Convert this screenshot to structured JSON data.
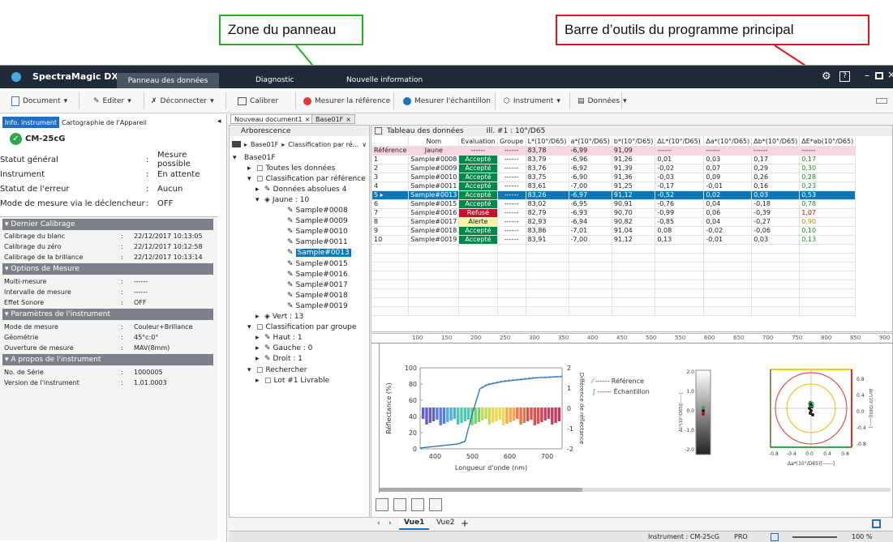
{
  "callouts": {
    "panel_zone": "Zone du panneau",
    "main_toolbar": "Barre d’outils du programme principal"
  },
  "colors": {
    "callout_panel": "#22b21e",
    "callout_toolbar": "#e0141e",
    "titlebar": "#1f2a36",
    "accept": "#00884a",
    "refuse": "#c8102e",
    "alert": "#f7f3a3",
    "selected_row": "#0d77b8"
  },
  "app": {
    "title": "SpectraMagic DX",
    "tabs": [
      "Panneau des données",
      "Diagnostic",
      "Nouvelle information"
    ],
    "title_icons": [
      "gear-icon",
      "help-icon",
      "minimize-icon",
      "restore-icon",
      "close-icon"
    ]
  },
  "toolbar": {
    "document": "Document",
    "edit": "Editer",
    "disconnect": "Déconnecter",
    "calibrate": "Calibrer",
    "measure_ref": "Mesurer la référence",
    "measure_sample": "Mesurer l'échantillon",
    "instrument": "Instrument",
    "data": "Données"
  },
  "left": {
    "tabs": [
      "Info. instrument",
      "Cartographie de l'Appareil"
    ],
    "model": "CM-25cG",
    "status": [
      {
        "label": "Statut général",
        "value": "Mesure possible"
      },
      {
        "label": "Instrument",
        "value": "En attente"
      },
      {
        "label": "Statut de l'erreur",
        "value": "Aucun"
      },
      {
        "label": "Mode de mesure via le déclencheur",
        "value": "OFF"
      }
    ],
    "sections": [
      {
        "title": "Dernier Calibrage",
        "rows": [
          {
            "label": "Calibrage du blanc",
            "value": "22/12/2017 10:13:05"
          },
          {
            "label": "Calibrage du zéro",
            "value": "22/12/2017 10:12:58"
          },
          {
            "label": "Calibrage de la brillance",
            "value": "22/12/2017 10:13:14"
          }
        ]
      },
      {
        "title": "Options de Mesure",
        "rows": [
          {
            "label": "Multi-mesure",
            "value": "------"
          },
          {
            "label": "Intervalle de mesure",
            "value": "------"
          },
          {
            "label": "Effet Sonore",
            "value": "OFF"
          }
        ]
      },
      {
        "title": "Paramètres de l'instrument",
        "rows": [
          {
            "label": "Mode de mesure",
            "value": "Couleur+Brillance"
          },
          {
            "label": "Géométrie",
            "value": "45°c:0°"
          },
          {
            "label": "Ouverture de mesure",
            "value": "MAV(8mm)"
          }
        ]
      },
      {
        "title": "A propos de l'instrument",
        "rows": [
          {
            "label": "No. de Série",
            "value": "1000005"
          },
          {
            "label": "Version de l'instrument",
            "value": "1.01.0003"
          }
        ]
      }
    ]
  },
  "doc_tabs": [
    "Nouveau document1",
    "Base01F"
  ],
  "tree": {
    "header": "Arborescence",
    "breadcrumb": [
      "Base01F",
      "Classification par ré..."
    ],
    "items": [
      "Base01F",
      "Toutes les données",
      "Classification par référence",
      "Données absolues 4",
      "Jaune : 10",
      "Sample#0008",
      "Sample#0009",
      "Sample#0010",
      "Sample#0011",
      "Sample#0013",
      "Sample#0015",
      "Sample#0016",
      "Sample#0017",
      "Sample#0018",
      "Sample#0019",
      "Vert : 13",
      "Classification par groupe",
      "Haut : 1",
      "Gauche : 0",
      "Droit : 1",
      "Rechercher",
      "Lot #1 Livrable"
    ]
  },
  "table": {
    "title": "Tableau des données",
    "illuminant": "Ill. #1 : 10°/D65",
    "columns": [
      "",
      "Nom",
      "Evaluation",
      "Groupe",
      "L*(10°/D65)",
      "a*(10°/D65)",
      "b*(10°/D65)",
      "ΔL*(10°/D65)",
      "Δa*(10°/D65)",
      "Δb*(10°/D65)",
      "ΔE*ab(10°/D65)"
    ],
    "reference": [
      "Référence",
      "Jaune",
      "------",
      "------",
      "83,78",
      "-6,99",
      "91,09",
      "------",
      "------",
      "------",
      "------"
    ],
    "rows": [
      [
        "1",
        "Sample#0008",
        "Accepté",
        "------",
        "83,79",
        "-6,96",
        "91,26",
        "0,01",
        "0,03",
        "0,17",
        "0,17"
      ],
      [
        "2",
        "Sample#0009",
        "Accepté",
        "------",
        "83,76",
        "-6,92",
        "91,39",
        "-0,02",
        "0,07",
        "0,29",
        "0,30"
      ],
      [
        "3",
        "Sample#0010",
        "Accepté",
        "------",
        "83,75",
        "-6,90",
        "91,36",
        "-0,03",
        "0,09",
        "0,26",
        "0,28"
      ],
      [
        "4",
        "Sample#0011",
        "Accepté",
        "------",
        "83,61",
        "-7,00",
        "91,25",
        "-0,17",
        "-0,01",
        "0,16",
        "0,23"
      ],
      [
        "5",
        "Sample#0013",
        "Accepté",
        "------",
        "83,26",
        "-6,97",
        "91,12",
        "-0,52",
        "0,02",
        "0,03",
        "0,53"
      ],
      [
        "6",
        "Sample#0015",
        "Accepté",
        "------",
        "83,02",
        "-6,95",
        "90,91",
        "-0,76",
        "0,04",
        "-0,18",
        "0,78"
      ],
      [
        "7",
        "Sample#0016",
        "Refusé",
        "------",
        "82,79",
        "-6,93",
        "90,70",
        "-0,99",
        "0,06",
        "-0,39",
        "1,07"
      ],
      [
        "8",
        "Sample#0017",
        "Alerte",
        "------",
        "82,93",
        "-6,94",
        "90,82",
        "-0,85",
        "0,04",
        "-0,27",
        "0,90"
      ],
      [
        "9",
        "Sample#0018",
        "Accepté",
        "------",
        "83,86",
        "-7,01",
        "91,04",
        "0,08",
        "-0,02",
        "-0,06",
        "0,10"
      ],
      [
        "10",
        "Sample#0019",
        "Accepté",
        "------",
        "83,91",
        "-7,00",
        "91,12",
        "0,13",
        "-0,01",
        "0,03",
        "0,13"
      ]
    ]
  },
  "ruler": [
    "100",
    "150",
    "200",
    "250",
    "300",
    "350",
    "400",
    "450",
    "500",
    "550",
    "600",
    "650",
    "700",
    "750",
    "800",
    "850",
    "900"
  ],
  "chart": {
    "ylabel": "Réflectance (%)",
    "y2label": "Différence de réflectance",
    "xlabel": "Longueur d'onde (nm)",
    "yticks": [
      "100",
      "80",
      "60",
      "40",
      "20",
      "0"
    ],
    "y2ticks": [
      "2",
      "1",
      "0",
      "-1",
      "-2"
    ],
    "xticks": [
      "400",
      "500",
      "600",
      "700"
    ],
    "legend": [
      "------ Référence",
      "------ Échantillon"
    ]
  },
  "chart_data": {
    "type": "line",
    "x": [
      360,
      380,
      400,
      420,
      440,
      460,
      480,
      500,
      520,
      540,
      560,
      580,
      600,
      620,
      640,
      660,
      680,
      700,
      720,
      740
    ],
    "series": [
      {
        "values": [
          1,
          2,
          3,
          4,
          5,
          6,
          10,
          45,
          75,
          80,
          82,
          84,
          85,
          86,
          87,
          88,
          88,
          89,
          89,
          90
        ]
      },
      {
        "values": [
          1,
          2,
          3,
          4,
          5,
          6,
          9,
          44,
          74,
          79,
          81,
          83,
          84,
          85,
          86,
          87,
          88,
          88,
          89,
          89
        ]
      }
    ],
    "ylim": [
      0,
      100
    ],
    "xlim": [
      360,
      740
    ],
    "y2lim": [
      -2,
      2
    ]
  },
  "lgauge": {
    "ticks": [
      "2.0",
      "1.0",
      "0.0",
      "-1.0",
      "-2.0"
    ],
    "label": "ΔL*(10°/D65)[------]"
  },
  "ab": {
    "yticks": [
      "0.8",
      "0.4",
      "0.0",
      "-0.4",
      "-0.8"
    ],
    "xticks": [
      "-0.8",
      "-0.4",
      "0.0",
      "0.4",
      "0.8"
    ],
    "xlabel": "Δa*(10°/D65)[------]",
    "ylabel": "Δb*(10°/D65)[------]"
  },
  "views": [
    "Vue1",
    "Vue2",
    "+"
  ],
  "status": {
    "instrument": "Instrument : CM-25cG",
    "mode": "PRO",
    "zoom": "100 %"
  }
}
